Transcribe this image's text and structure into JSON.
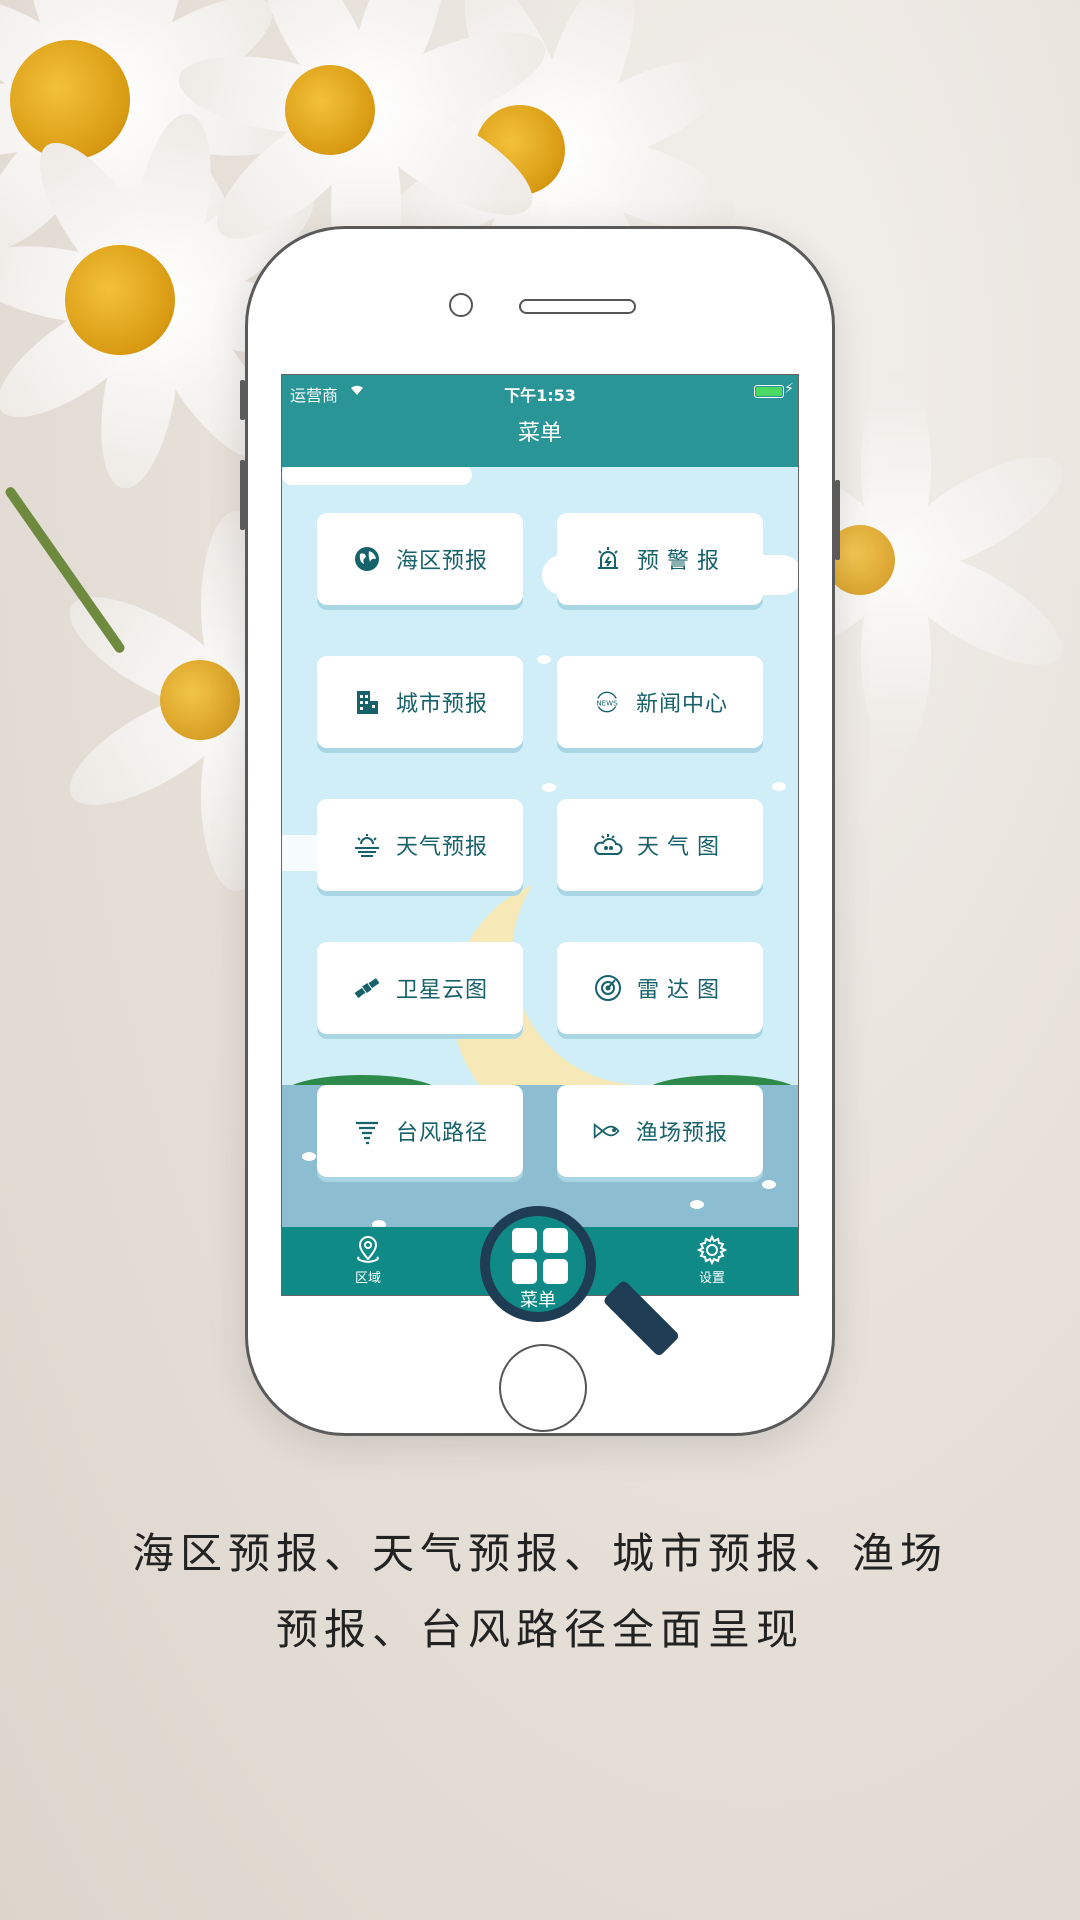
{
  "status_bar": {
    "carrier": "运营商",
    "time": "下午1:53"
  },
  "nav": {
    "title": "菜单"
  },
  "menu": [
    {
      "label": "海区预报",
      "icon": "globe-icon"
    },
    {
      "label": "预警报",
      "icon": "alarm-icon"
    },
    {
      "label": "城市预报",
      "icon": "building-icon"
    },
    {
      "label": "新闻中心",
      "icon": "news-icon"
    },
    {
      "label": "天气预报",
      "icon": "sun-cloud-icon"
    },
    {
      "label": "天气图",
      "icon": "weather-map-icon"
    },
    {
      "label": "卫星云图",
      "icon": "satellite-icon"
    },
    {
      "label": "雷达图",
      "icon": "radar-icon"
    },
    {
      "label": "台风路径",
      "icon": "typhoon-icon"
    },
    {
      "label": "渔场预报",
      "icon": "fish-icon"
    }
  ],
  "tabs": {
    "region": "区域",
    "menu": "菜单",
    "settings": "设置"
  },
  "news_icon_text": "NEWS",
  "caption": {
    "line1": "海区预报、天气预报、城市预报、渔场",
    "line2": "预报、台风路径全面呈现"
  },
  "colors": {
    "teal": "#2a9596",
    "tab": "#0f8a86",
    "text": "#17616a"
  }
}
